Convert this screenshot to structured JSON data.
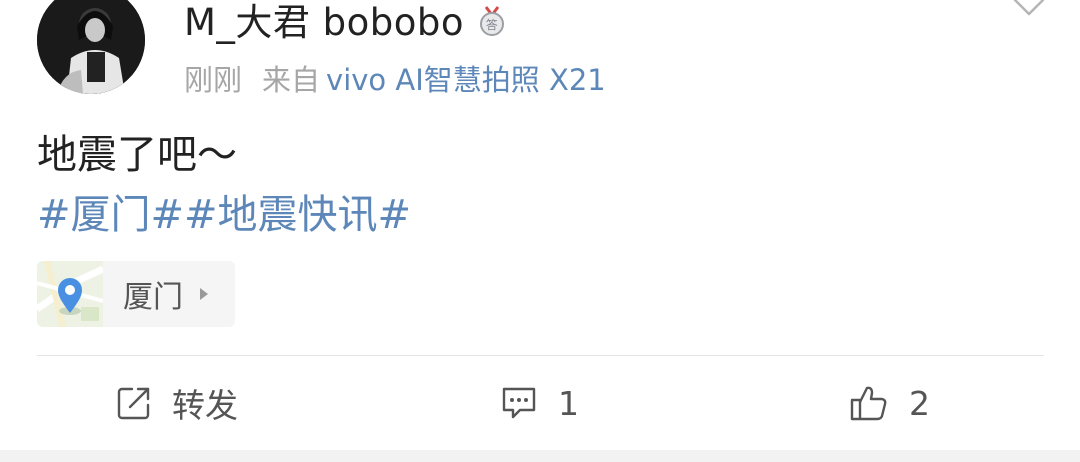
{
  "post": {
    "username": "M_大君 bobobo",
    "badge_icon": "answer-medal-icon",
    "time": "刚刚",
    "from_label": "来自",
    "device": "vivo AI智慧拍照 X21",
    "text": "地震了吧～",
    "topics": "#厦门##地震快讯#",
    "location": {
      "name": "厦门",
      "icon": "map-pin-icon"
    }
  },
  "actions": {
    "repost_label": "转发",
    "comment_count": "1",
    "like_count": "2"
  },
  "colors": {
    "link": "#5c87b8",
    "text": "#222222",
    "muted": "#a6a6a6",
    "pin": "#4a90e2"
  }
}
